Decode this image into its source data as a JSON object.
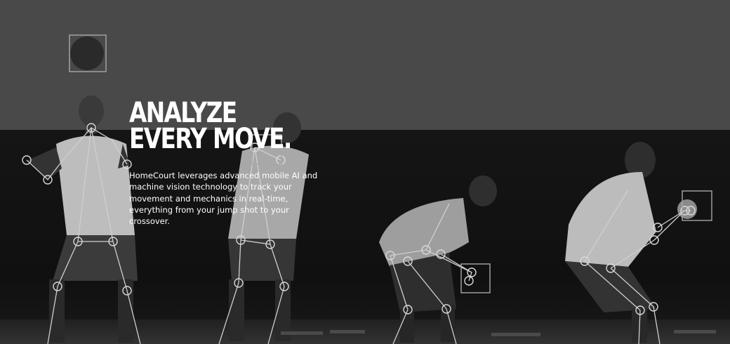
{
  "hero": {
    "headline_line1": "ANALYZE",
    "headline_line2": "EVERY MOVE.",
    "description": "HomeCourt leverages advanced mobile AI and machine vision technology to track your movement and mechanics in real-time, everything from your jump shot to your crossover."
  },
  "image": {
    "subject": "four-basketball-player-poses-with-pose-tracking-skeleton-overlay",
    "colors": {
      "background": "#474747",
      "wall": "#121212",
      "tracking_line": "#c8c8c8",
      "text": "#ffffff"
    }
  }
}
